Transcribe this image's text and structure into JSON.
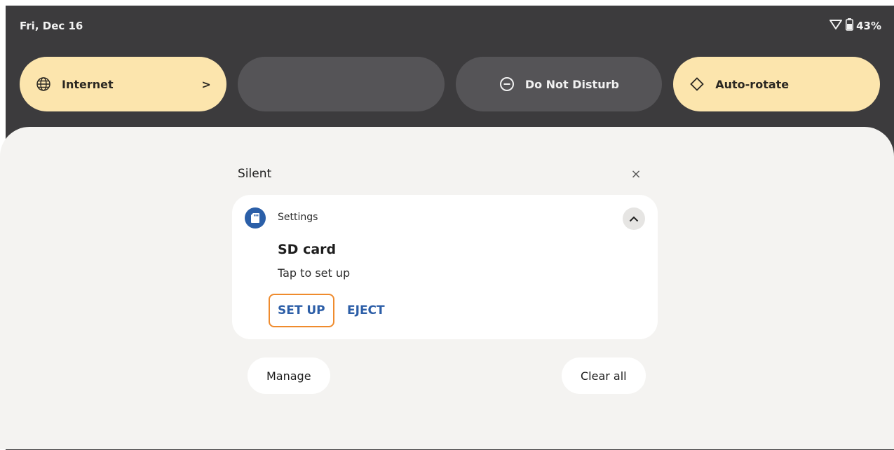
{
  "status_bar": {
    "date": "Fri, Dec 16",
    "battery": "43%",
    "icons": [
      "wifi-icon",
      "battery-icon"
    ]
  },
  "quick_tiles": [
    {
      "label": "Internet",
      "icon": "globe-icon",
      "state": "on",
      "chevron": ">"
    },
    {
      "label": "",
      "icon": "",
      "state": "off"
    },
    {
      "label": "Do Not Disturb",
      "icon": "do-not-disturb-icon",
      "state": "off"
    },
    {
      "label": "Auto-rotate",
      "icon": "rotate-icon",
      "state": "on"
    }
  ],
  "notifications": {
    "section_title": "Silent",
    "dismiss_label": "×",
    "card": {
      "app_name": "Settings",
      "title": "SD card",
      "text": "Tap to set up",
      "actions": [
        "SET UP",
        "EJECT"
      ]
    },
    "manage_label": "Manage",
    "clear_all_label": "Clear all"
  },
  "colors": {
    "accent": "#2c5ea7",
    "tile_on": "#fce5ad",
    "tile_off": "#555457",
    "shade_background": "#3c3b3d",
    "highlight_border": "#ef8b2d"
  }
}
